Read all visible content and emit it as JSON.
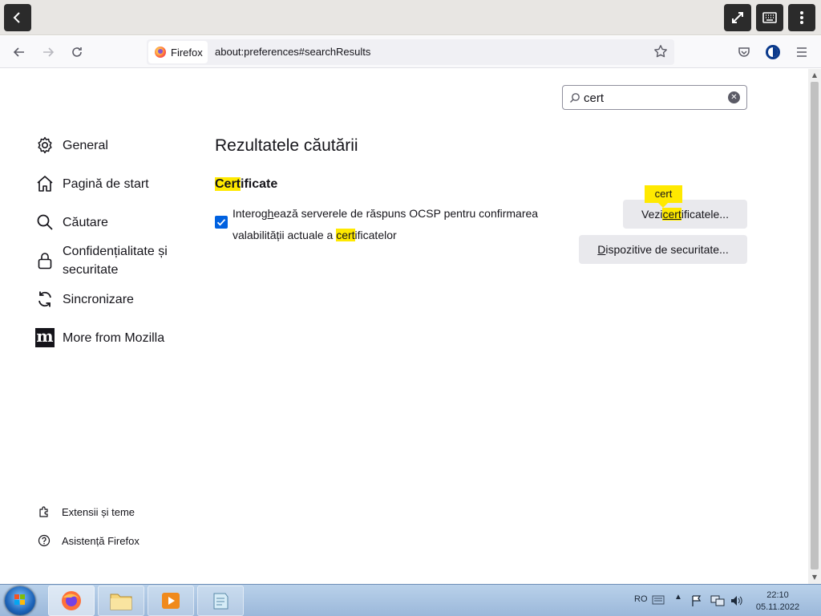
{
  "session_bar": {
    "back_icon": "chevron-left-icon",
    "fullscreen_icon": "expand-icon",
    "keyboard_icon": "keyboard-icon",
    "menu_icon": "vertical-dots-icon"
  },
  "browser": {
    "identity_label": "Firefox",
    "url": "about:preferences#searchResults"
  },
  "search": {
    "value": "cert"
  },
  "sidebar": {
    "items": [
      {
        "label": "General",
        "icon": "gear-icon"
      },
      {
        "label": "Pagină de start",
        "icon": "home-icon"
      },
      {
        "label": "Căutare",
        "icon": "search-icon"
      },
      {
        "label": "Confidențialitate și securitate",
        "icon": "lock-icon"
      },
      {
        "label": "Sincronizare",
        "icon": "sync-icon"
      },
      {
        "label": "More from Mozilla",
        "icon": "mozilla-icon"
      }
    ],
    "footer": [
      {
        "label": "Extensii și teme",
        "icon": "puzzle-icon"
      },
      {
        "label": "Asistență Firefox",
        "icon": "help-icon"
      }
    ]
  },
  "main": {
    "title": "Rezultatele căutării",
    "section": {
      "title_highlight": "Cert",
      "title_rest": "ificate",
      "checkbox_checked": true,
      "checkbox_label_part1": "Interog",
      "checkbox_label_accesskey": "h",
      "checkbox_label_part2": "ează serverele de răspuns OCSP pentru confirmarea valabilității actuale a ",
      "checkbox_label_highlight": "cert",
      "checkbox_label_part3": "ificatelor",
      "view_certs_prefix": "Vezi ",
      "view_certs_highlight": "cert",
      "view_certs_suffix": "ificatele...",
      "security_devices_accesskey": "D",
      "security_devices_rest": "ispozitive de securitate...",
      "tooltip": "cert"
    }
  },
  "taskbar": {
    "language": "RO",
    "time": "22:10",
    "date": "05.11.2022"
  },
  "colors": {
    "highlight": "#ffe900",
    "checkbox_accent": "#0061e0",
    "button_bg": "#e9e9ed"
  }
}
